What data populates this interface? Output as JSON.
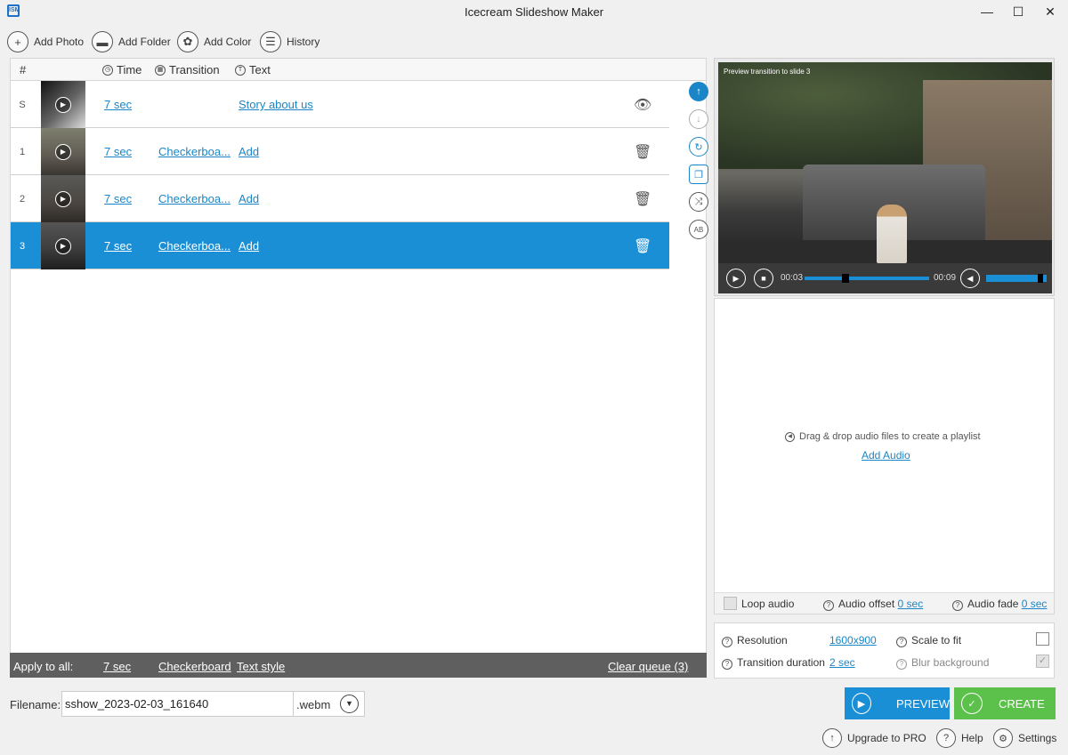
{
  "window": {
    "title": "Icecream Slideshow Maker",
    "app_icon_text": "ISM",
    "minimize": "—",
    "maximize": "☐",
    "close": "✕"
  },
  "toolbar": {
    "add_photo": "Add Photo",
    "add_folder": "Add Folder",
    "add_color": "Add Color",
    "history": "History"
  },
  "table": {
    "headers": {
      "num": "#",
      "time": "Time",
      "transition": "Transition",
      "text": "Text"
    },
    "rows": [
      {
        "num": "S",
        "time": "7 sec",
        "transition": "",
        "text": "Story about us",
        "action": "eye-icon",
        "selected": false
      },
      {
        "num": "1",
        "time": "7 sec",
        "transition": "Checkerboa...",
        "text": "Add",
        "action": "trash-icon",
        "selected": false
      },
      {
        "num": "2",
        "time": "7 sec",
        "transition": "Checkerboa...",
        "text": "Add",
        "action": "trash-icon",
        "selected": false
      },
      {
        "num": "3",
        "time": "7 sec",
        "transition": "Checkerboa...",
        "text": "Add",
        "action": "trash-icon",
        "selected": true
      }
    ]
  },
  "apply_bar": {
    "label": "Apply to all:",
    "time": "7 sec",
    "transition": "Checkerboard",
    "text_style": "Text style",
    "clear_queue": "Clear queue (3)"
  },
  "preview": {
    "caption": "Preview transition to slide 3",
    "current_time": "00:03",
    "total_time": "00:09",
    "progress": 0.33,
    "volume": 0.9
  },
  "audio": {
    "drop_hint": "Drag & drop audio files to create a playlist",
    "add_audio": "Add Audio",
    "loop_audio": "Loop audio",
    "audio_offset": "Audio offset",
    "audio_offset_value": "0 sec",
    "audio_fade": "Audio fade",
    "audio_fade_value": "0 sec"
  },
  "settings": {
    "resolution": "Resolution",
    "resolution_value": "1600x900",
    "scale_to_fit": "Scale to fit",
    "transition_duration": "Transition duration",
    "transition_duration_value": "2 sec",
    "blur_background": "Blur background"
  },
  "output": {
    "filename_label": "Filename:",
    "filename": "sshow_2023-02-03_161640",
    "extension": ".webm"
  },
  "actions": {
    "preview": "PREVIEW",
    "create": "CREATE",
    "upgrade": "Upgrade to PRO",
    "help": "Help",
    "settings": "Settings"
  },
  "colors": {
    "accent": "#1a8fd6",
    "create_green": "#5cc14a",
    "apply_bar": "#5f5f5f"
  }
}
